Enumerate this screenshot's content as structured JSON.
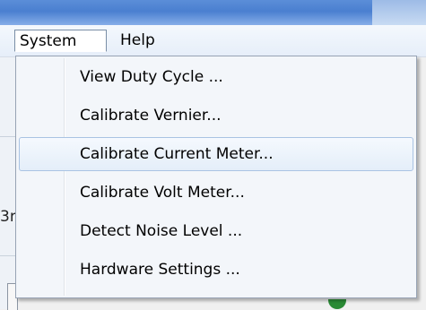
{
  "menubar": {
    "items": [
      {
        "label": "System"
      },
      {
        "label": "Help"
      }
    ]
  },
  "background": {
    "fragment_text": "3r"
  },
  "dropdown": {
    "items": [
      {
        "label": "View Duty Cycle ..."
      },
      {
        "label": "Calibrate Vernier..."
      },
      {
        "label": "Calibrate Current Meter..."
      },
      {
        "label": "Calibrate Volt Meter..."
      },
      {
        "label": "Detect Noise Level ..."
      },
      {
        "label": "Hardware Settings ..."
      }
    ],
    "highlighted": "Calibrate Current Meter..."
  },
  "colors": {
    "highlight_border": "#a9c3e3",
    "highlight_fill": "#e4eef9",
    "menu_background": "#f3f6fa",
    "titlebar": "#4a7fd0"
  }
}
